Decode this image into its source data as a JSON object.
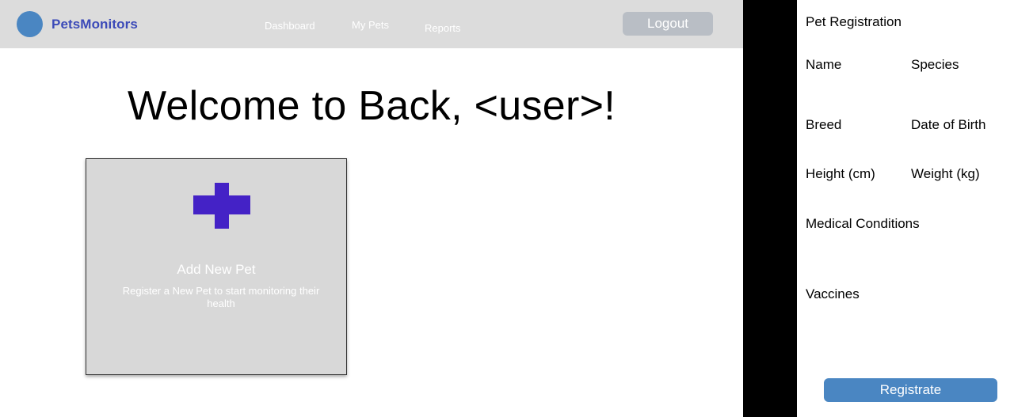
{
  "header": {
    "brand": "PetsMonitors",
    "nav": {
      "dashboard": "Dashboard",
      "my_pets": "My Pets",
      "reports": "Reports"
    },
    "logout_label": "Logout"
  },
  "main": {
    "welcome": "Welcome to Back, <user>!",
    "add_card": {
      "title": "Add New Pet",
      "description": "Register a New Pet to start monitoring their health",
      "icon": "plus-icon"
    }
  },
  "registration": {
    "title": "Pet Registration",
    "labels": {
      "name": "Name",
      "species": "Species",
      "breed": "Breed",
      "date_of_birth": "Date of Birth",
      "height": "Height (cm)",
      "weight": "Weight (kg)",
      "medical_conditions": "Medical Conditions",
      "vaccines": "Vaccines"
    },
    "submit_label": "Registrate"
  },
  "colors": {
    "header_bg": "#dcdcdc",
    "brand": "#3b4ab8",
    "accent": "#4a86c2",
    "plus": "#4422c6",
    "logout_bg": "#b9bec5"
  }
}
